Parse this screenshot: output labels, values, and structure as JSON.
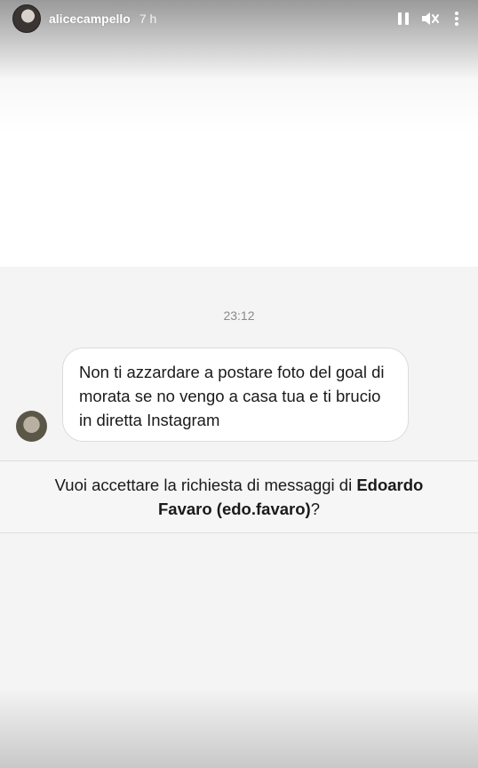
{
  "header": {
    "username": "alicecampello",
    "time_ago": "7 h",
    "icons": [
      "pause-icon",
      "mute-icon",
      "more-icon"
    ]
  },
  "chat": {
    "timestamp": "23:12",
    "message": "Non ti azzardare a postare foto del goal di morata se no vengo a casa tua e ti brucio in diretta Instagram"
  },
  "request": {
    "prefix": "Vuoi accettare la richiesta di messaggi di ",
    "name": "Edoardo Favaro (edo.favaro)",
    "suffix": "?"
  },
  "colors": {
    "accent_text": "#1a1a1a",
    "muted_text": "#8a8a8a",
    "bubble_border": "#dcdcdc"
  }
}
